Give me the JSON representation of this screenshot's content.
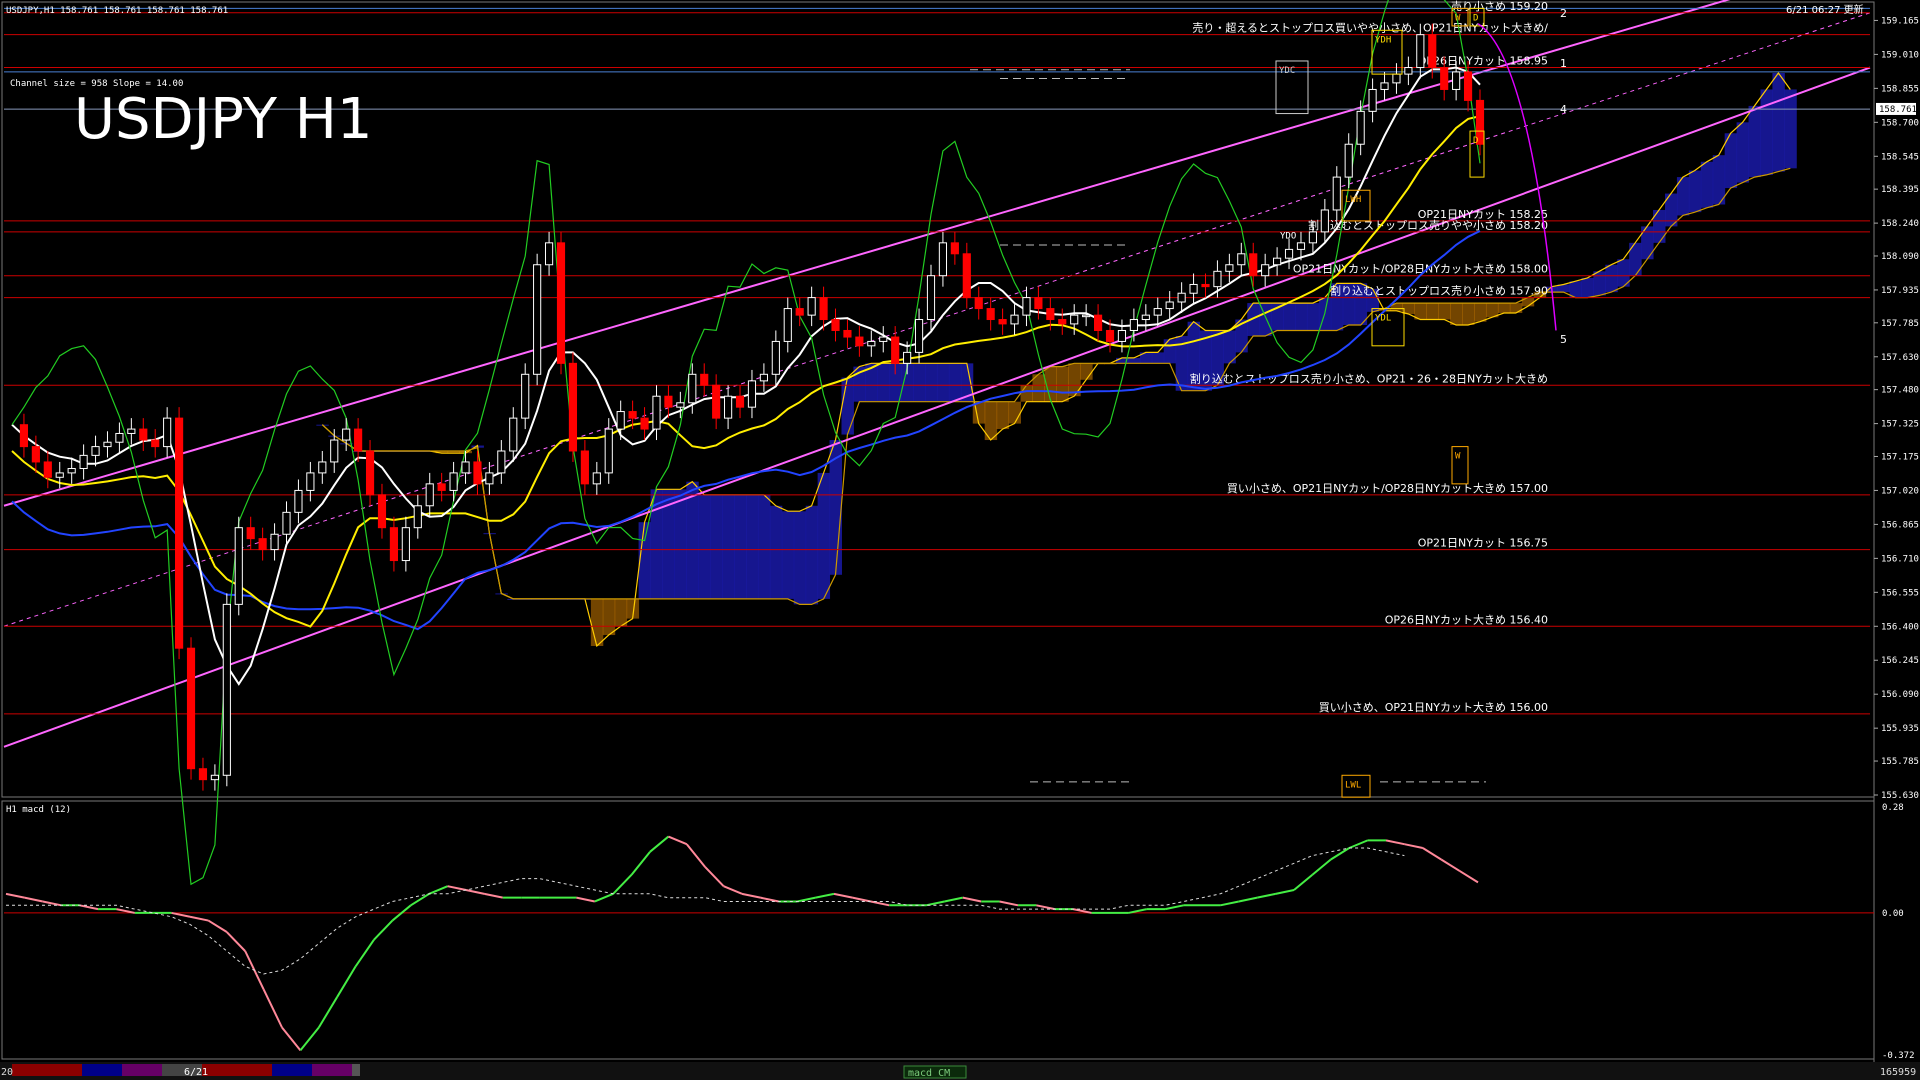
{
  "header": {
    "symbol_info": "USDJPY,H1  158.761 158.761 158.761 158.761",
    "channel_info": "Channel size = 958 Slope = 14.00",
    "big_title": "USDJPY H1",
    "updated": "6/21 06:27 更新"
  },
  "price_axis": {
    "ticks": [
      "159.165",
      "159.010",
      "158.855",
      "158.700",
      "158.545",
      "158.395",
      "158.240",
      "158.090",
      "157.935",
      "157.785",
      "157.630",
      "157.480",
      "157.325",
      "157.175",
      "157.020",
      "156.865",
      "156.710",
      "156.555",
      "156.400",
      "156.245",
      "156.090",
      "155.935",
      "155.785",
      "155.630"
    ],
    "current_price": "158.761"
  },
  "macd_axis": {
    "top": "0.28",
    "zero": "0.00",
    "bottom": "-0.372"
  },
  "macd_title": "H1  macd (12)",
  "bottom_bar": {
    "left_label": "20",
    "date_label": "6/21",
    "center_label": "macd CM",
    "right_label": "165959"
  },
  "levels": [
    {
      "price": 159.2,
      "text": "売り小さめ 159.20"
    },
    {
      "price": 159.1,
      "text": "売り・超えるとストップロス買いやや小さめ、OP21日NYカット大きめ/"
    },
    {
      "price": 158.95,
      "text": "OP26日NYカット 158.95"
    },
    {
      "price": 158.25,
      "text": "OP21日NYカット 158.25"
    },
    {
      "price": 158.2,
      "text": "割り込むとストップロス売りやや小さめ 158.20"
    },
    {
      "price": 158.0,
      "text": "OP21日NYカット/OP28日NYカット大きめ 158.00"
    },
    {
      "price": 157.9,
      "text": "割り込むとストップロス売り小さめ 157.90"
    },
    {
      "price": 157.5,
      "text": "割り込むとストップロス売り小さめ、OP21・26・28日NYカット大きめ"
    },
    {
      "price": 157.0,
      "text": "買い小さめ、OP21日NYカット/OP28日NYカット大きめ 157.00"
    },
    {
      "price": 156.75,
      "text": "OP21日NYカット 156.75"
    },
    {
      "price": 156.4,
      "text": "OP26日NYカット大きめ 156.40"
    },
    {
      "price": 156.0,
      "text": "買い小さめ、OP21日NYカット大きめ 156.00"
    }
  ],
  "box_labels": {
    "ydc": "YDC",
    "ydh": "YDH",
    "ydo": "YDO",
    "ydl": "YDL",
    "lwh": "LWH",
    "lwl": "LWL",
    "w": "W",
    "d": "D"
  },
  "wave_labels": [
    "2",
    "1",
    "4",
    "5"
  ],
  "colors": {
    "level_line": "#cc0000",
    "hline_blue": "#4a7fd4",
    "channel": "#ff66ff",
    "cloud_blue": "#1a1aa8",
    "cloud_orange": "#ff9900",
    "sma_white": "#ffffff",
    "sma_yellow": "#ffee00",
    "sma_blue": "#2244ff",
    "green_line": "#22cc22",
    "candle_up": "#ffffff",
    "candle_down": "#ff0000",
    "macd_up": "#44ee44",
    "macd_down": "#ff8899"
  },
  "chart_data": {
    "type": "candlestick",
    "symbol": "USDJPY",
    "timeframe": "H1",
    "ylim": [
      155.63,
      159.24
    ],
    "closes": [
      157.32,
      157.22,
      157.15,
      157.08,
      157.1,
      157.12,
      157.18,
      157.22,
      157.24,
      157.28,
      157.3,
      157.25,
      157.22,
      157.35,
      156.3,
      155.75,
      155.7,
      155.72,
      156.5,
      156.85,
      156.8,
      156.75,
      156.82,
      156.92,
      157.02,
      157.1,
      157.15,
      157.25,
      157.3,
      157.2,
      157.0,
      156.85,
      156.7,
      156.85,
      156.95,
      157.05,
      157.02,
      157.1,
      157.15,
      157.05,
      157.1,
      157.2,
      157.35,
      157.55,
      158.05,
      158.15,
      157.6,
      157.2,
      157.05,
      157.1,
      157.3,
      157.38,
      157.35,
      157.3,
      157.45,
      157.4,
      157.42,
      157.55,
      157.5,
      157.35,
      157.45,
      157.4,
      157.52,
      157.55,
      157.7,
      157.85,
      157.82,
      157.9,
      157.8,
      157.75,
      157.72,
      157.68,
      157.7,
      157.72,
      157.6,
      157.65,
      157.8,
      158.0,
      158.15,
      158.1,
      157.9,
      157.85,
      157.8,
      157.78,
      157.82,
      157.9,
      157.85,
      157.8,
      157.78,
      157.82,
      157.82,
      157.75,
      157.7,
      157.75,
      157.8,
      157.82,
      157.85,
      157.88,
      157.92,
      157.96,
      157.95,
      158.02,
      158.05,
      158.1,
      158.0,
      158.05,
      158.08,
      158.12,
      158.15,
      158.2,
      158.3,
      158.45,
      158.6,
      158.75,
      158.85,
      158.88,
      158.92,
      158.95,
      159.1,
      158.95,
      158.85,
      158.93,
      158.8,
      158.6
    ],
    "macd": [
      0.05,
      0.04,
      0.03,
      0.02,
      0.02,
      0.01,
      0.01,
      0.0,
      0.0,
      0.0,
      -0.01,
      -0.02,
      -0.05,
      -0.1,
      -0.2,
      -0.3,
      -0.36,
      -0.3,
      -0.22,
      -0.14,
      -0.07,
      -0.02,
      0.02,
      0.05,
      0.07,
      0.06,
      0.05,
      0.04,
      0.04,
      0.04,
      0.04,
      0.04,
      0.03,
      0.05,
      0.1,
      0.16,
      0.2,
      0.18,
      0.12,
      0.07,
      0.05,
      0.04,
      0.03,
      0.03,
      0.04,
      0.05,
      0.04,
      0.03,
      0.02,
      0.02,
      0.02,
      0.03,
      0.04,
      0.03,
      0.03,
      0.02,
      0.02,
      0.01,
      0.01,
      0.0,
      0.0,
      0.0,
      0.01,
      0.01,
      0.02,
      0.02,
      0.02,
      0.03,
      0.04,
      0.05,
      0.06,
      0.1,
      0.14,
      0.17,
      0.19,
      0.19,
      0.18,
      0.17,
      0.14,
      0.11,
      0.08
    ],
    "signal": [
      0.02,
      0.02,
      0.02,
      0.02,
      0.02,
      0.02,
      0.02,
      0.01,
      0.0,
      -0.01,
      -0.03,
      -0.06,
      -0.1,
      -0.14,
      -0.16,
      -0.15,
      -0.12,
      -0.08,
      -0.04,
      -0.01,
      0.01,
      0.03,
      0.04,
      0.05,
      0.05,
      0.06,
      0.07,
      0.08,
      0.09,
      0.09,
      0.08,
      0.07,
      0.06,
      0.05,
      0.05,
      0.05,
      0.04,
      0.04,
      0.04,
      0.03,
      0.03,
      0.03,
      0.03,
      0.03,
      0.03,
      0.03,
      0.03,
      0.03,
      0.03,
      0.02,
      0.02,
      0.02,
      0.02,
      0.02,
      0.01,
      0.01,
      0.01,
      0.01,
      0.01,
      0.01,
      0.01,
      0.02,
      0.02,
      0.02,
      0.03,
      0.04,
      0.05,
      0.07,
      0.09,
      0.11,
      0.13,
      0.15,
      0.16,
      0.17,
      0.17,
      0.16,
      0.15
    ]
  }
}
